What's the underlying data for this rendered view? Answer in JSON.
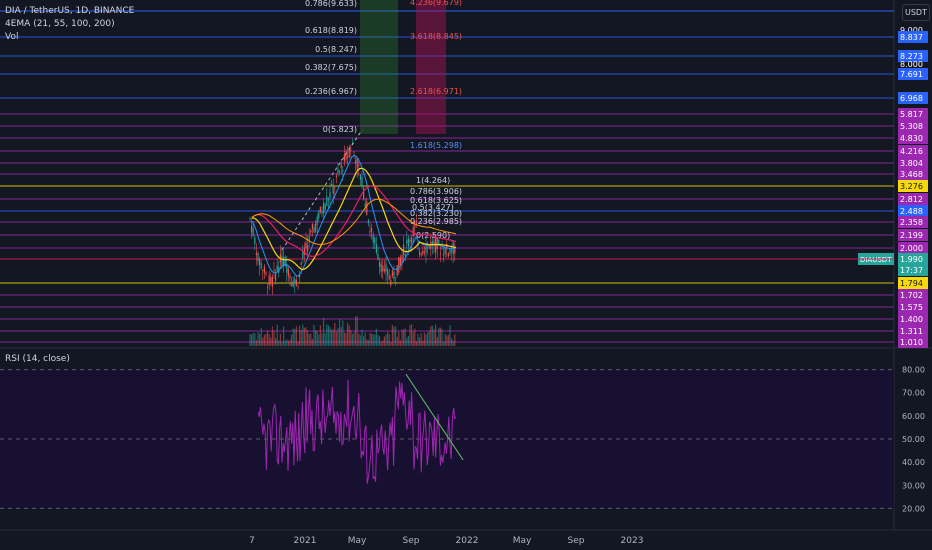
{
  "header": {
    "title": "DIA / TetherUS, 1D, BINANCE",
    "indicator_ema": "4EMA (21, 55, 100, 200)",
    "indicator_vol": "Vol",
    "currency_button": "USDT"
  },
  "rsi": {
    "title": "RSI (14, close)",
    "axis_labels": [
      "80.00",
      "70.00",
      "60.00",
      "50.00",
      "40.00",
      "30.00",
      "20.00"
    ],
    "axis_values": [
      80,
      70,
      60,
      50,
      40,
      30,
      20
    ]
  },
  "time_axis": {
    "labels": [
      "7",
      "2021",
      "May",
      "Sep",
      "2022",
      "May",
      "Sep",
      "2023"
    ]
  },
  "price_axis": {
    "labels": [
      {
        "text": "9.000",
        "bg": "transparent"
      },
      {
        "text": "8.837",
        "bg": "#2962ff"
      },
      {
        "text": "8.273",
        "bg": "#2962ff"
      },
      {
        "text": "8.000",
        "bg": "transparent"
      },
      {
        "text": "7.691",
        "bg": "#2962ff"
      },
      {
        "text": "6.968",
        "bg": "#2962ff"
      },
      {
        "text": "5.817",
        "bg": "#9c27b0"
      },
      {
        "text": "5.308",
        "bg": "#9c27b0"
      },
      {
        "text": "4.830",
        "bg": "#9c27b0"
      },
      {
        "text": "4.216",
        "bg": "#9c27b0"
      },
      {
        "text": "3.804",
        "bg": "#9c27b0"
      },
      {
        "text": "3.468",
        "bg": "#9c27b0"
      },
      {
        "text": "3.276",
        "bg": "#f5d90a"
      },
      {
        "text": "2.812",
        "bg": "#9c27b0"
      },
      {
        "text": "2.488",
        "bg": "#2962ff"
      },
      {
        "text": "2.358",
        "bg": "#9c27b0"
      },
      {
        "text": "2.199",
        "bg": "#9c27b0"
      },
      {
        "text": "2.000",
        "bg": "#9c27b0"
      },
      {
        "text": "1.990",
        "bg": "#26a69a"
      },
      {
        "text": "17:37",
        "bg": "#26a69a"
      },
      {
        "text": "1.794",
        "bg": "#f5d90a"
      },
      {
        "text": "1.702",
        "bg": "#9c27b0"
      },
      {
        "text": "1.575",
        "bg": "#9c27b0"
      },
      {
        "text": "1.400",
        "bg": "#9c27b0"
      },
      {
        "text": "1.311",
        "bg": "#9c27b0"
      },
      {
        "text": "1.010",
        "bg": "#9c27b0"
      }
    ],
    "symbol_tag": "DIAUSDT"
  },
  "fib_left": [
    "0.786(9.633)",
    "0.618(8.819)",
    "0.5(8.247)",
    "0.382(7.675)",
    "0.236(6.967)",
    "0(5.823)"
  ],
  "fib_right": [
    "4.236(9.679)",
    "3.618(8.845)",
    "2.618(6.971)",
    "1.618(5.298)"
  ],
  "fib_mid": [
    "1(4.264)",
    "0.786(3.906)",
    "0.618(3.625)",
    "0.5(3.427)",
    "0.382(3.230)",
    "0.236(2.985)",
    "0(2.590)"
  ],
  "colors": {
    "background": "#131722",
    "rsi_background": "#1a1033",
    "rsi_line": "#9c27b0",
    "blue_level": "#2962ff",
    "purple_level": "#9c27b0",
    "yellow_level": "#f5d90a",
    "green_bar": "#26a69a",
    "red_bar": "#ef5350",
    "ema_21": "#f5d90a",
    "ema_55": "#e91e63"
  }
}
